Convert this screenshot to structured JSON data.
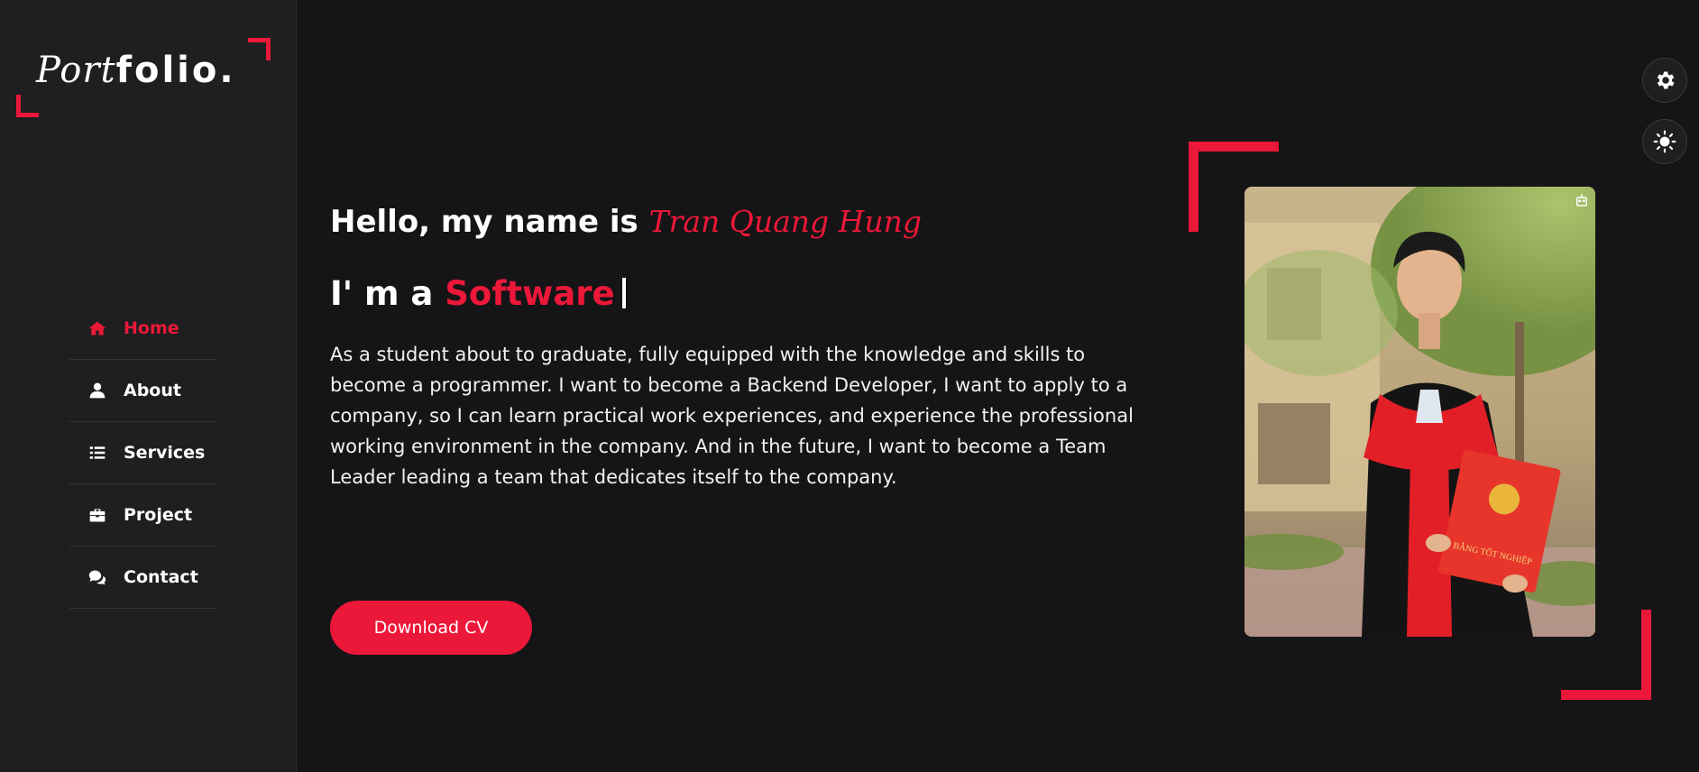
{
  "sidebar": {
    "logo": {
      "script_part": "Port",
      "bold_part": "folio."
    },
    "nav": [
      {
        "label": "Home",
        "icon": "home-icon",
        "active": true
      },
      {
        "label": "About",
        "icon": "user-icon",
        "active": false
      },
      {
        "label": "Services",
        "icon": "list-icon",
        "active": false
      },
      {
        "label": "Project",
        "icon": "briefcase-icon",
        "active": false
      },
      {
        "label": "Contact",
        "icon": "comments-icon",
        "active": false
      }
    ]
  },
  "hero": {
    "greeting_prefix": "Hello, my name is",
    "name": "Tran Quang Hung",
    "role_prefix": "I' m a",
    "role_highlight": "Software",
    "description": "As a student about to graduate, fully equipped with the knowledge and skills to become a programmer. I want to become a Backend Developer, I want to apply to a company, so I can learn practical work experiences, and experience the professional working environment in the company. And in the future, I want to become a Team Leader leading a team that dedicates itself to the company.",
    "download_label": "Download CV"
  },
  "photo": {
    "certificate_text": "BẰNG TỐT NGHIỆP"
  },
  "controls": {
    "settings_icon": "gear-icon",
    "theme_icon": "sun-icon"
  },
  "colors": {
    "accent": "#ec1839",
    "background": "#151416",
    "sidebar": "#1f1e20"
  }
}
